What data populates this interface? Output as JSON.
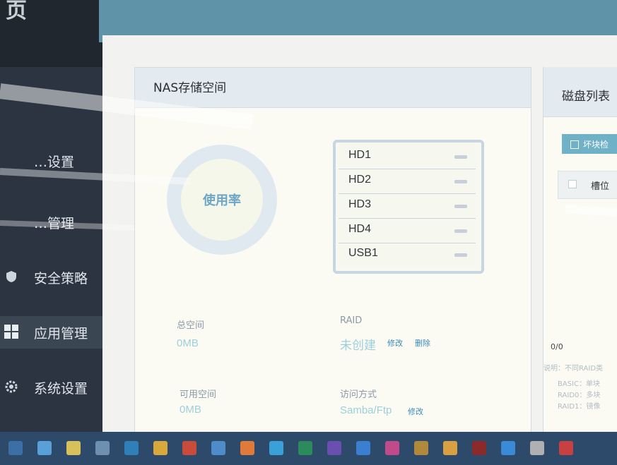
{
  "sidebar": {
    "header": "页",
    "items": [
      {
        "label": "…设置"
      },
      {
        "label": "…管理"
      },
      {
        "label": "安全策略"
      },
      {
        "label": "应用管理"
      },
      {
        "label": "系统设置"
      }
    ]
  },
  "nas_panel": {
    "title": "NAS存储空间",
    "usage_label": "使用率",
    "disks": [
      "HD1",
      "HD2",
      "HD3",
      "HD4",
      "USB1"
    ],
    "total_space_label": "总空间",
    "total_space_value": "0MB",
    "available_space_label": "可用空间",
    "available_space_value": "0MB",
    "raid_label": "RAID",
    "raid_value": "未创建",
    "raid_edit": "修改",
    "raid_delete": "删除",
    "access_label": "访问方式",
    "access_value": "Samba/Ftp",
    "access_edit": "修改"
  },
  "disk_list": {
    "title": "磁盘列表",
    "bad_block_button": "坏块检",
    "slot_column": "槽位",
    "pager": "0/0",
    "notes": [
      "说明：不同RAID类",
      "BASIC：单块",
      "RAID0：多块",
      "RAID1：镜像"
    ]
  },
  "colors": {
    "sidebar_bg": "#2b3440",
    "topbar_bg": "#5e93a8",
    "accent": "#6fb2c8",
    "value_text": "#9cd0da",
    "taskbar_bg": "#2d4a6a"
  },
  "taskbar": {
    "icons": [
      "start-icon",
      "ie-icon",
      "folder-icon",
      "app-icon",
      "store-icon",
      "chrome-icon",
      "settings-icon",
      "media-icon",
      "app-icon",
      "app-icon",
      "app-icon",
      "app-icon",
      "app-icon",
      "app-icon",
      "app-icon",
      "app-icon",
      "app-icon",
      "app-icon",
      "app-icon",
      "app-icon"
    ]
  }
}
